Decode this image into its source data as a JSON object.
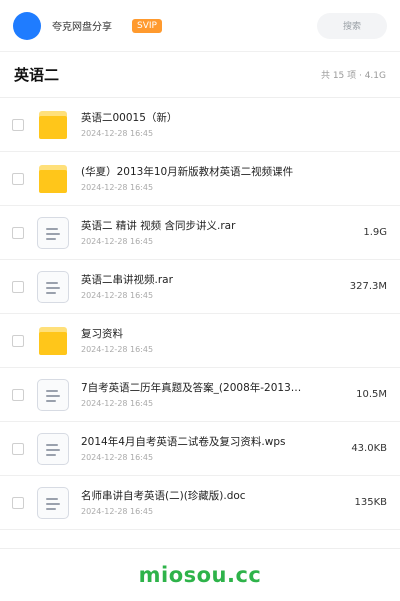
{
  "header": {
    "username": "夸克网盘分享",
    "badge": "SVIP",
    "search_placeholder": "搜索"
  },
  "folder": {
    "title": "英语二",
    "stats": "共 15 项 · 4.1G"
  },
  "files": [
    {
      "icon": "folder-icon",
      "name": "英语二00015（新）",
      "date": "2024-12-28 16:45",
      "size": ""
    },
    {
      "icon": "folder-icon",
      "name": "(华夏）2013年10月新版教材英语二视频课件",
      "date": "2024-12-28 16:45",
      "size": ""
    },
    {
      "icon": "document-icon",
      "name": "英语二 精讲 视频 含同步讲义.rar",
      "date": "2024-12-28 16:45",
      "size": "1.9G"
    },
    {
      "icon": "document-icon",
      "name": "英语二串讲视频.rar",
      "date": "2024-12-28 16:45",
      "size": "327.3M"
    },
    {
      "icon": "folder-icon",
      "name": "复习资料",
      "date": "2024-12-28 16:45",
      "size": ""
    },
    {
      "icon": "document-icon",
      "name": "7自考英语二历年真题及答案_(2008年-2013…",
      "date": "2024-12-28 16:45",
      "size": "10.5M"
    },
    {
      "icon": "document-icon",
      "name": "2014年4月自考英语二试卷及复习资料.wps",
      "date": "2024-12-28 16:45",
      "size": "43.0KB"
    },
    {
      "icon": "document-icon",
      "name": "名师串讲自考英语(二)(珍藏版).doc",
      "date": "2024-12-28 16:45",
      "size": "135KB"
    }
  ],
  "footer": {
    "brand": "miosou.cc"
  },
  "colors": {
    "accent": "#1f7cff",
    "svip": "#ff9a2e",
    "folder": "#ffc61a",
    "brand": "#2eb34a"
  }
}
